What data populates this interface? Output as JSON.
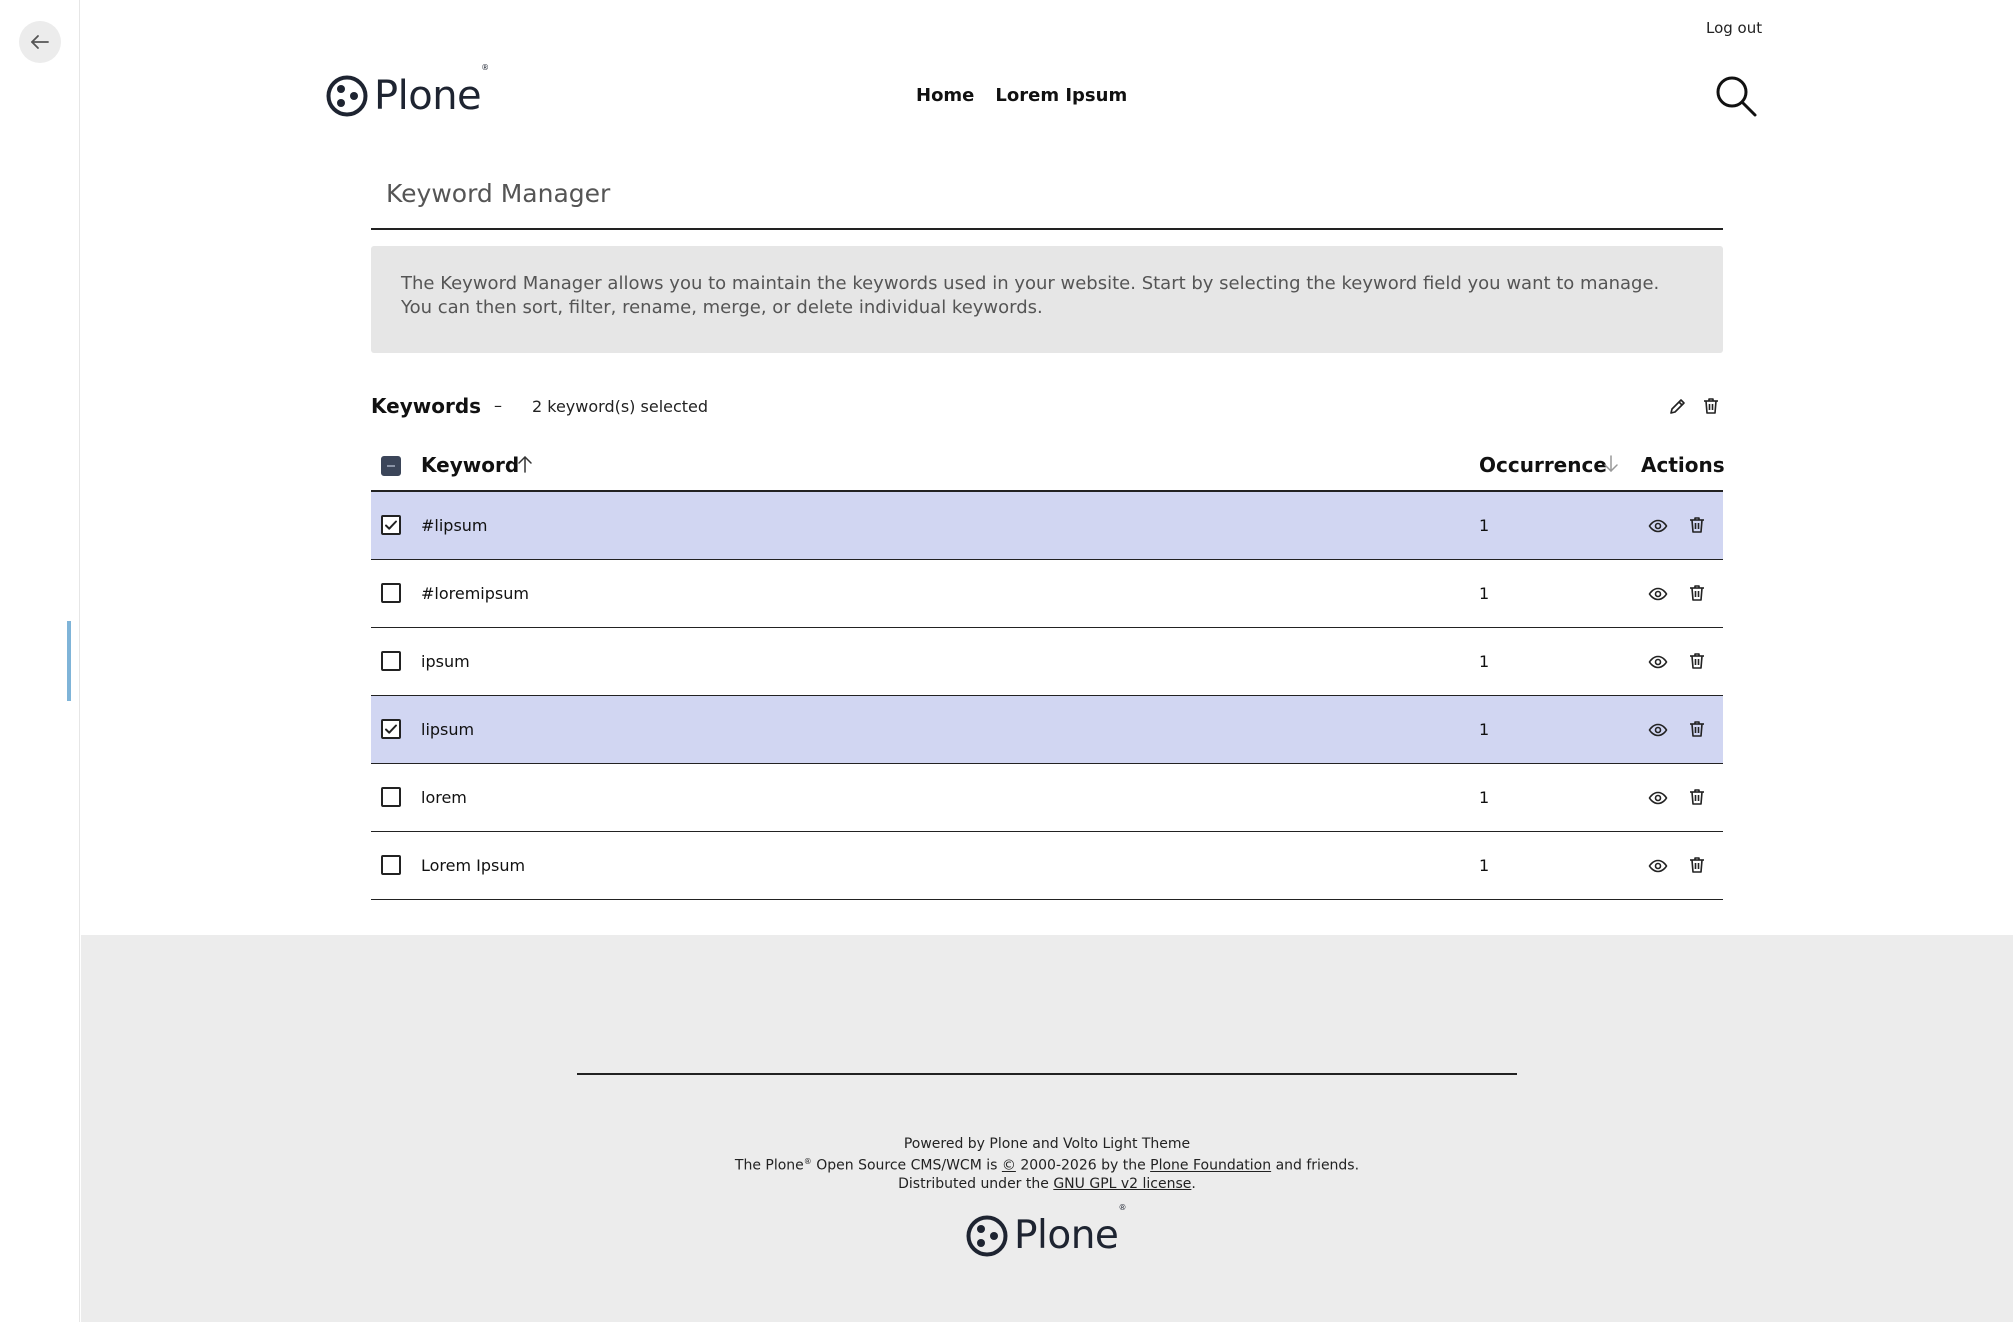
{
  "header": {
    "logout": "Log out",
    "logo_text": "Plone",
    "logo_reg": "®",
    "nav": [
      "Home",
      "Lorem Ipsum"
    ]
  },
  "main": {
    "title": "Keyword Manager",
    "description": "The Keyword Manager allows you to maintain the keywords used in your website. Start by selecting the keyword field you want to manage. You can then sort, filter, rename, merge, or delete individual keywords.",
    "keywords_title": "Keywords",
    "dash": "–",
    "selected_count": "2 keyword(s) selected"
  },
  "table": {
    "col_keyword": "Keyword",
    "col_occurrence": "Occurrence",
    "col_actions": "Actions",
    "rows": [
      {
        "keyword": "#lipsum",
        "occurrence": "1",
        "selected": true
      },
      {
        "keyword": "#loremipsum",
        "occurrence": "1",
        "selected": false
      },
      {
        "keyword": "ipsum",
        "occurrence": "1",
        "selected": false
      },
      {
        "keyword": "lipsum",
        "occurrence": "1",
        "selected": true
      },
      {
        "keyword": "lorem",
        "occurrence": "1",
        "selected": false
      },
      {
        "keyword": "Lorem Ipsum",
        "occurrence": "1",
        "selected": false
      }
    ]
  },
  "footer": {
    "line1": "Powered by Plone and Volto Light Theme",
    "line2_a": "The Plone",
    "line2_reg": "®",
    "line2_b": " Open Source CMS/WCM is ",
    "line2_copy": "©",
    "line2_c": " 2000-2026 by the ",
    "line2_link": "Plone Foundation",
    "line2_d": " and friends.",
    "line3_a": "Distributed under the ",
    "line3_link": "GNU GPL v2 license",
    "line3_b": ".",
    "logo_text": "Plone",
    "logo_reg": "®"
  },
  "colors": {
    "selected_row": "#d1d6f2",
    "info_box": "#e6e6e6",
    "footer_bg": "#ececec",
    "toolbar_indicator": "#7fb4d8"
  }
}
